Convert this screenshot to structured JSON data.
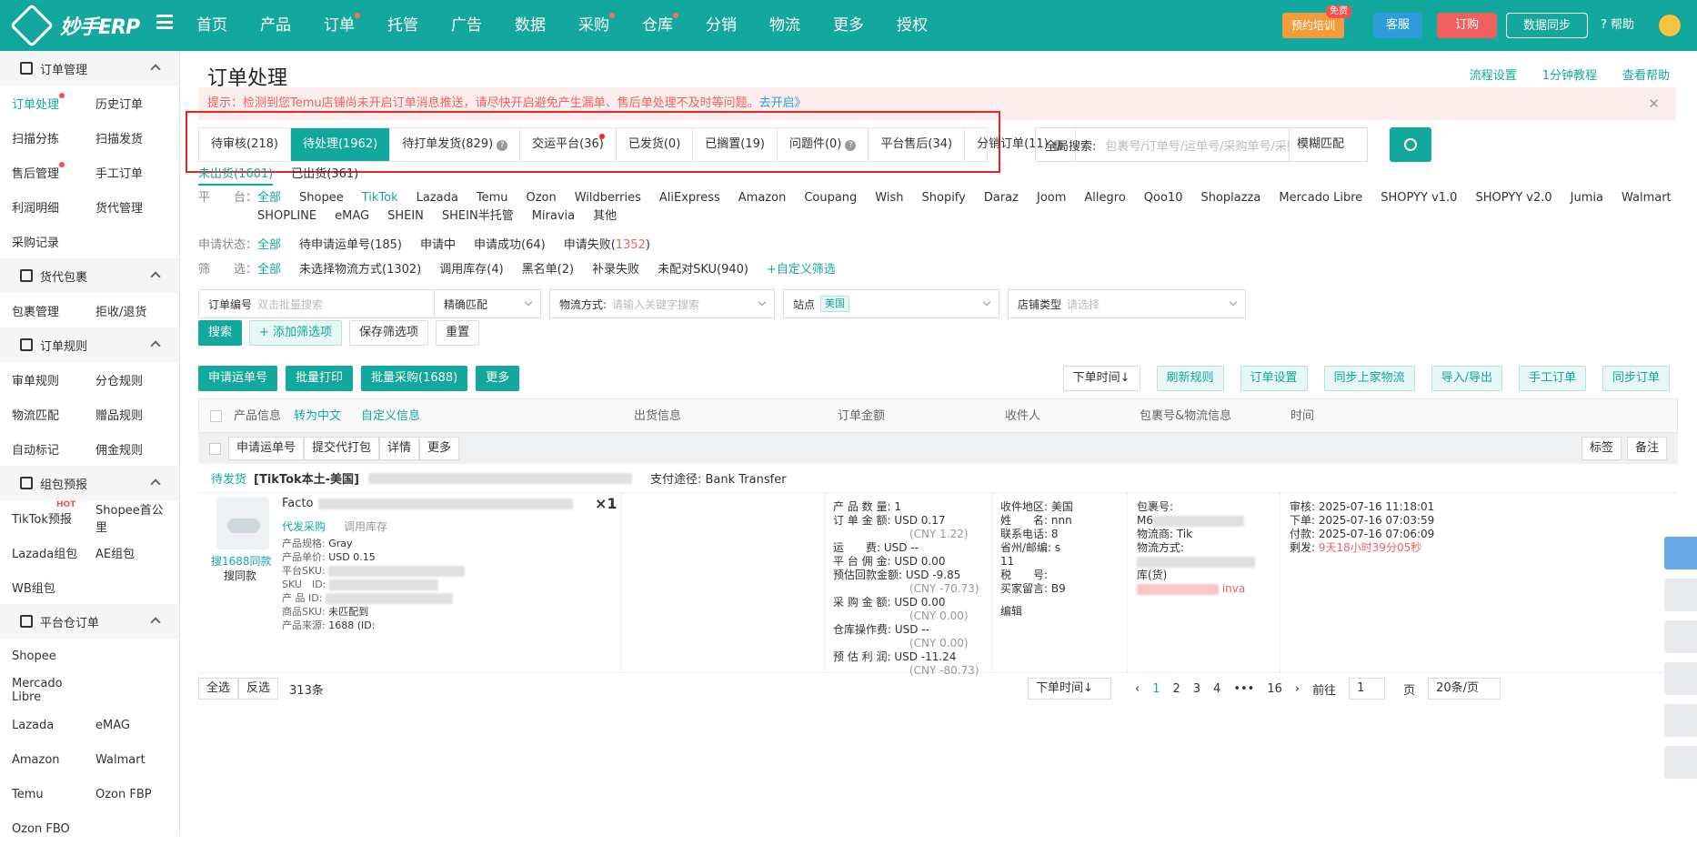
{
  "header": {
    "logo": "妙手ERP",
    "nav": [
      {
        "label": "首页",
        "dot": false
      },
      {
        "label": "产品",
        "dot": false
      },
      {
        "label": "订单",
        "dot": true
      },
      {
        "label": "托管",
        "dot": false
      },
      {
        "label": "广告",
        "dot": false
      },
      {
        "label": "数据",
        "dot": false
      },
      {
        "label": "采购",
        "dot": true
      },
      {
        "label": "仓库",
        "dot": true
      },
      {
        "label": "分销",
        "dot": false
      },
      {
        "label": "物流",
        "dot": false
      },
      {
        "label": "更多",
        "dot": false
      },
      {
        "label": "授权",
        "dot": false
      }
    ],
    "train": "预约培训",
    "free": "免费",
    "kefu": "客服",
    "order": "订购",
    "sync": "数据同步",
    "help": "帮助"
  },
  "sidebar": [
    {
      "group": "订单管理",
      "rows": [
        [
          {
            "label": "订单处理",
            "active": true,
            "dot": true
          },
          {
            "label": "历史订单"
          }
        ],
        [
          {
            "label": "扫描分拣"
          },
          {
            "label": "扫描发货"
          }
        ],
        [
          {
            "label": "售后管理",
            "dot": true
          },
          {
            "label": "手工订单"
          }
        ],
        [
          {
            "label": "利润明细"
          },
          {
            "label": "货代管理"
          }
        ],
        [
          {
            "label": "采购记录"
          }
        ]
      ]
    },
    {
      "group": "货代包裹",
      "rows": [
        [
          {
            "label": "包裹管理"
          },
          {
            "label": "拒收/退货"
          }
        ]
      ]
    },
    {
      "group": "订单规则",
      "rows": [
        [
          {
            "label": "审单规则"
          },
          {
            "label": "分仓规则"
          }
        ],
        [
          {
            "label": "物流匹配"
          },
          {
            "label": "赠品规则"
          }
        ],
        [
          {
            "label": "自动标记"
          },
          {
            "label": "佣金规则"
          }
        ]
      ]
    },
    {
      "group": "组包预报",
      "rows": [
        [
          {
            "label": "TikTok预报",
            "hot": "HOT"
          },
          {
            "label": "Shopee首公里"
          }
        ],
        [
          {
            "label": "Lazada组包"
          },
          {
            "label": "AE组包"
          }
        ],
        [
          {
            "label": "WB组包"
          }
        ]
      ]
    },
    {
      "group": "平台仓订单",
      "rows": [
        [
          {
            "label": "Shopee"
          }
        ],
        [
          {
            "label": "Mercado Libre"
          }
        ],
        [
          {
            "label": "Lazada"
          },
          {
            "label": "eMAG"
          }
        ],
        [
          {
            "label": "Amazon"
          },
          {
            "label": "Walmart"
          }
        ],
        [
          {
            "label": "Temu"
          },
          {
            "label": "Ozon FBP"
          }
        ],
        [
          {
            "label": "Ozon FBO"
          }
        ]
      ]
    }
  ],
  "page": {
    "title": "订单处理",
    "links": [
      "流程设置",
      "1分钟教程",
      "查看帮助"
    ],
    "notice": "提示：检测到您Temu店铺尚未开启订单消息推送，请尽快开启避免产生漏单、售后单处理不及时等问题。",
    "notice_link": "去开启》",
    "tabs": [
      {
        "label": "待审核(218)"
      },
      {
        "label": "待处理(1962)",
        "active": true
      },
      {
        "label": "待打单发货(829)",
        "q": true
      },
      {
        "label": "交运平台(36)",
        "dot": true
      },
      {
        "label": "已发货(0)"
      },
      {
        "label": "已搁置(19)"
      },
      {
        "label": "问题件(0)",
        "q": true
      },
      {
        "label": "平台售后(34)"
      },
      {
        "label": "分销订单(11)",
        "q": true
      }
    ],
    "gsearch": {
      "label": "全局搜索:",
      "placeholder": "包裹号/订单号/运单号/采购单号/采购物流单号",
      "mode": "模糊匹配"
    },
    "subtabs": [
      {
        "label": "未出货(1601)",
        "active": true
      },
      {
        "label": "已出货(361)"
      }
    ],
    "platform_label": "平　　台：",
    "platforms": [
      "全部",
      "Shopee",
      "TikTok",
      "Lazada",
      "Temu",
      "Ozon",
      "Wildberries",
      "AliExpress",
      "Amazon",
      "Coupang",
      "Wish",
      "Shopify",
      "Daraz",
      "Joom",
      "Allegro",
      "Qoo10",
      "Shoplazza",
      "Mercado Libre",
      "SHOPYY v1.0",
      "SHOPYY v2.0",
      "Jumia",
      "Walmart",
      "SHOPLINE",
      "eMAG",
      "SHEIN",
      "SHEIN半托管",
      "Miravia",
      "其他"
    ],
    "apply_label": "申请状态：",
    "apply": [
      "全部",
      "待申请运单号(185)",
      "申请中",
      "申请成功(64)",
      "申请失败("
    ],
    "apply_fail": "1352",
    "apply_close": ")",
    "filter_label": "筛　　选：",
    "filters": [
      "全部",
      "未选择物流方式(1302)",
      "调用库存(4)",
      "黑名单(2)",
      "补录失败",
      "未配对SKU(940)",
      "+自定义筛选"
    ],
    "inputs": {
      "order_no": "订单编号",
      "order_ph": "双击批量搜索",
      "match": "精确匹配",
      "ship": "物流方式:",
      "ship_ph": "请输入关键字搜索",
      "site": "站点",
      "site_tag": "美国",
      "store": "店铺类型",
      "store_ph": "请选择"
    },
    "btns": {
      "search": "搜索",
      "add": "+ 添加筛选项",
      "save": "保存筛选项",
      "reset": "重置"
    },
    "toolbar": {
      "left": [
        "申请运单号",
        "批量打印",
        "批量采购(1688)",
        "更多"
      ],
      "right": [
        "下单时间↓",
        "刷新规则",
        "订单设置",
        "同步上家物流",
        "导入/导出",
        "手工订单",
        "同步订单"
      ]
    },
    "thead": [
      "产品信息",
      "转为中文",
      "自定义信息",
      "出货信息",
      "订单金额",
      "收件人",
      "包裹号&物流信息",
      "时间"
    ],
    "bulk": [
      "申请运单号",
      "提交代打包",
      "详情",
      "更多"
    ],
    "bulk_right": [
      "标签",
      "备注"
    ],
    "order": {
      "status": "待发货",
      "shop": "[TikTok本土-美国]",
      "pay": "支付途径: Bank Transfer",
      "product": {
        "name": "Facto",
        "qty": "×1",
        "buy": "代发采购",
        "stock": "调用库存",
        "search": "搜1688同款",
        "same": "搜同款",
        "spec": "产品规格:",
        "spec_v": "Gray",
        "price": "产品单价:",
        "price_v": "USD 0.15",
        "psku": "平台SKU:",
        "sku": "SKU　ID:",
        "pid": "产 品 ID:",
        "msku": "商品SKU:",
        "msku_v": "未匹配到",
        "src": "产品来源:",
        "src_v": "1688 (ID:"
      },
      "amount": [
        [
          "产 品 数 量:",
          "1"
        ],
        [
          "订 单 金 额:",
          "USD 0.17"
        ],
        [
          "",
          "(CNY 1.22)"
        ],
        [
          "运　　费:",
          "USD --"
        ],
        [
          "平 台 佣 金:",
          "USD 0.00"
        ],
        [
          "预估回款金额:",
          "USD -9.85"
        ],
        [
          "",
          "(CNY -70.73)"
        ],
        [
          "采 购 金 额:",
          "USD 0.00"
        ],
        [
          "",
          "(CNY 0.00)"
        ],
        [
          "仓库操作费:",
          "USD --"
        ],
        [
          "",
          "(CNY 0.00)"
        ],
        [
          "预 估 利 润:",
          "USD -11.24"
        ],
        [
          "",
          "(CNY -80.73)"
        ]
      ],
      "recv": [
        [
          "收件地区:",
          "美国"
        ],
        [
          "姓　　名:",
          "nnn"
        ],
        [
          "联系电话:",
          "8"
        ],
        [
          "省州/邮编:",
          "s"
        ],
        [
          "",
          "11"
        ],
        [
          "税　　号:",
          ""
        ],
        [
          "买家留言:",
          "B9"
        ]
      ],
      "edit": "编辑",
      "pkg": {
        "pkg_no": "包裹号:",
        "pkg_v": "M6",
        "carrier": "物流商:",
        "carrier_v": "Tik",
        "method": "物流方式:",
        "tail": "库(货)",
        "err": "inva"
      },
      "time": [
        [
          "审核:",
          "2025-07-16 11:18:01"
        ],
        [
          "下单:",
          "2025-07-16 07:03:59"
        ],
        [
          "付款:",
          "2025-07-16 07:06:09"
        ],
        [
          "剩发:",
          "9天18小时39分05秒"
        ]
      ]
    },
    "pager": {
      "all": "全选",
      "inv": "反选",
      "count": "313条",
      "sort": "下单时间↓",
      "pages": [
        "1",
        "2",
        "3",
        "4",
        "•••",
        "16"
      ],
      "goto": "前往",
      "goto_v": "1",
      "page": "页",
      "size": "20条/页"
    }
  }
}
